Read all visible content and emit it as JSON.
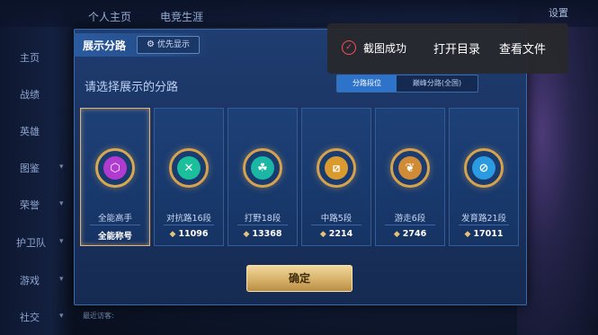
{
  "top_tabs": [
    "个人主页",
    "电竞生涯"
  ],
  "settings_label": "设置",
  "sidebar": {
    "items": [
      {
        "label": "主页",
        "chevron": false
      },
      {
        "label": "战绩",
        "chevron": false
      },
      {
        "label": "英雄",
        "chevron": false
      },
      {
        "label": "图鉴",
        "chevron": true
      },
      {
        "label": "荣誉",
        "chevron": true
      },
      {
        "label": "护卫队",
        "chevron": true
      },
      {
        "label": "游戏",
        "chevron": true
      },
      {
        "label": "社交",
        "chevron": true
      }
    ]
  },
  "bottom_hint": "最近访客:",
  "dialog": {
    "title": "展示分路",
    "priority_button": "优先显示",
    "prompt": "请选择展示的分路",
    "segment": {
      "options": [
        "分路段位",
        "巅峰分路(全国)"
      ],
      "selected": "分路段位"
    },
    "cards": [
      {
        "label": "全能高手",
        "value": "全能称号",
        "selected": true,
        "icon": "allround-emblem-icon",
        "accent": "#b13ad0"
      },
      {
        "label": "对抗路16段",
        "value": "11096",
        "selected": false,
        "icon": "clash-lane-emblem-icon",
        "accent": "#1bbf9b"
      },
      {
        "label": "打野18段",
        "value": "13368",
        "selected": false,
        "icon": "jungle-emblem-icon",
        "accent": "#19b7a4"
      },
      {
        "label": "中路5段",
        "value": "2214",
        "selected": false,
        "icon": "mid-lane-emblem-icon",
        "accent": "#d99a2e"
      },
      {
        "label": "游走6段",
        "value": "2746",
        "selected": false,
        "icon": "roam-emblem-icon",
        "accent": "#cf8b35"
      },
      {
        "label": "发育路21段",
        "value": "17011",
        "selected": false,
        "icon": "farm-lane-emblem-icon",
        "accent": "#2a9be0"
      }
    ],
    "confirm_label": "确定"
  },
  "toast": {
    "message": "截图成功",
    "open_dir": "打开目录",
    "view_file": "查看文件",
    "status_color": "#ff4d4d"
  }
}
